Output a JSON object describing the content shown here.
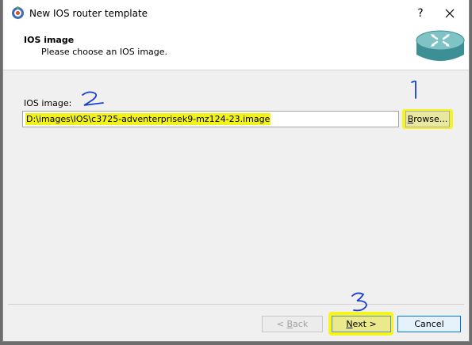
{
  "window": {
    "title": "New IOS router template",
    "help_glyph": "?"
  },
  "header": {
    "title": "IOS image",
    "subtitle": "Please choose an IOS image."
  },
  "form": {
    "label": "IOS image:",
    "value": "D:\\images\\IOS\\c3725-adventerprisek9-mz124-23.image"
  },
  "buttons": {
    "browse": "Browse...",
    "back": "< Back",
    "next": "Next >",
    "cancel": "Cancel"
  },
  "annotations": {
    "browse_number": "1",
    "field_number": "2",
    "next_number": "3",
    "ink_color": "#1a3fd0",
    "highlight_color": "#f5f51d"
  },
  "colors": {
    "router_body": "#3c8f94",
    "router_top": "#7fc3c6",
    "default_button_border": "#0078d7"
  },
  "icons": {
    "app": "gns3-app-icon",
    "router": "router-icon",
    "close": "close-icon"
  }
}
